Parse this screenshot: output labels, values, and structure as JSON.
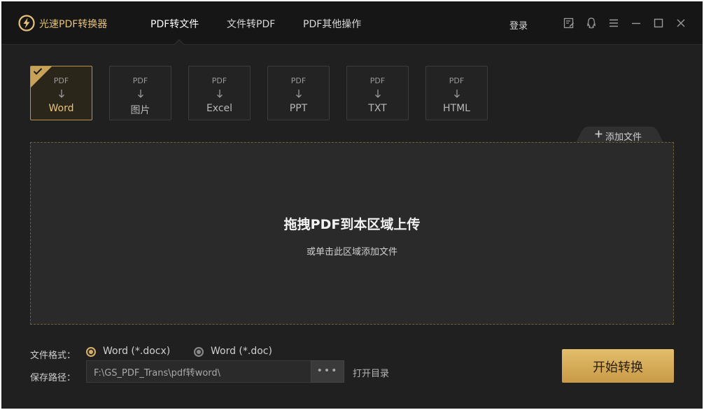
{
  "app": {
    "title": "光速PDF转换器",
    "accent_color": "#e6c27a",
    "logo_icon": "lightning-bolt-icon"
  },
  "nav": {
    "tabs": [
      {
        "label": "PDF转文件",
        "active": true
      },
      {
        "label": "文件转PDF",
        "active": false
      },
      {
        "label": "PDF其他操作",
        "active": false
      }
    ],
    "login_label": "登录"
  },
  "window_controls": [
    "edit-note-icon",
    "qq-icon",
    "menu-icon",
    "minimize-icon",
    "maximize-icon",
    "close-icon"
  ],
  "formats": [
    {
      "source": "PDF",
      "target": "Word",
      "selected": true
    },
    {
      "source": "PDF",
      "target": "图片",
      "selected": false
    },
    {
      "source": "PDF",
      "target": "Excel",
      "selected": false
    },
    {
      "source": "PDF",
      "target": "PPT",
      "selected": false
    },
    {
      "source": "PDF",
      "target": "TXT",
      "selected": false
    },
    {
      "source": "PDF",
      "target": "HTML",
      "selected": false
    }
  ],
  "add_file_label": "添加文件",
  "dropzone": {
    "title": "拖拽PDF到本区域上传",
    "subtitle": "或单击此区域添加文件"
  },
  "options": {
    "format_label": "文件格式：",
    "format_choices": [
      {
        "label": "Word (*.docx)",
        "checked": true
      },
      {
        "label": "Word (*.doc)",
        "checked": false
      }
    ],
    "path_label": "保存路径：",
    "path_value": "F:\\GS_PDF_Trans\\pdf转word\\",
    "browse_label": "•••",
    "open_dir_label": "打开目录"
  },
  "start_button_label": "开始转换"
}
